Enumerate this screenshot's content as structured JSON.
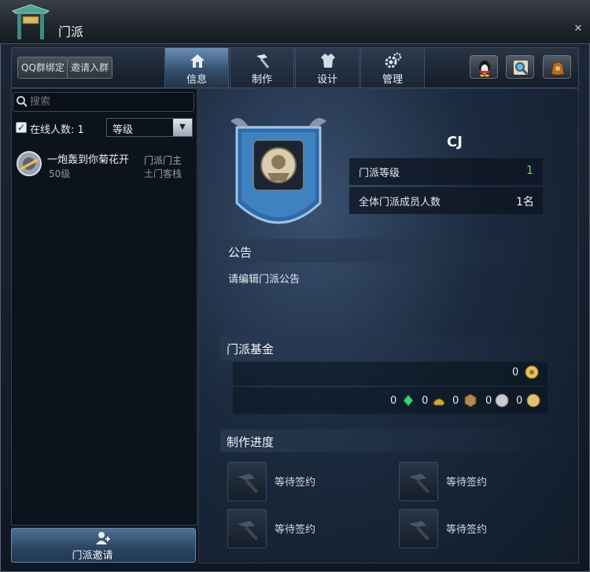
{
  "window": {
    "title": "门派"
  },
  "toolbar": {
    "qq_bind": "QQ群绑定",
    "invite_group": "邀请入群",
    "tabs": [
      {
        "label": "信息",
        "icon": "house-icon",
        "active": true
      },
      {
        "label": "制作",
        "icon": "hammer-icon",
        "active": false
      },
      {
        "label": "设计",
        "icon": "robe-icon",
        "active": false
      },
      {
        "label": "管理",
        "icon": "gears-icon",
        "active": false
      }
    ],
    "icons": [
      "qq-penguin-icon",
      "magnifier-icon",
      "bag-icon"
    ]
  },
  "left": {
    "search": {
      "placeholder": "搜索",
      "value": "搜索"
    },
    "online_label": "在线人数: 1",
    "online_checked": true,
    "sort": {
      "selected": "等级"
    },
    "members": [
      {
        "name": "一炮轰到你菊花开",
        "level": "50级",
        "rank": "门派门主",
        "location": "土门客栈"
      }
    ],
    "invite_button": "门派邀请"
  },
  "guild": {
    "name": "CJ",
    "level_label": "门派等级",
    "level_value": "1",
    "members_label": "全体门派成员人数",
    "members_value": "1名"
  },
  "notice": {
    "title": "公告",
    "text": "请编辑门派公告"
  },
  "fund": {
    "title": "门派基金",
    "gold": "0",
    "materials": [
      "0",
      "0",
      "0",
      "0",
      "0"
    ]
  },
  "craft": {
    "title": "制作进度",
    "slots": [
      "等待签约",
      "等待签约",
      "等待签约",
      "等待签约"
    ]
  },
  "colors": {
    "accent_green": "#7cd46a",
    "panel_bg": "#111b29"
  }
}
